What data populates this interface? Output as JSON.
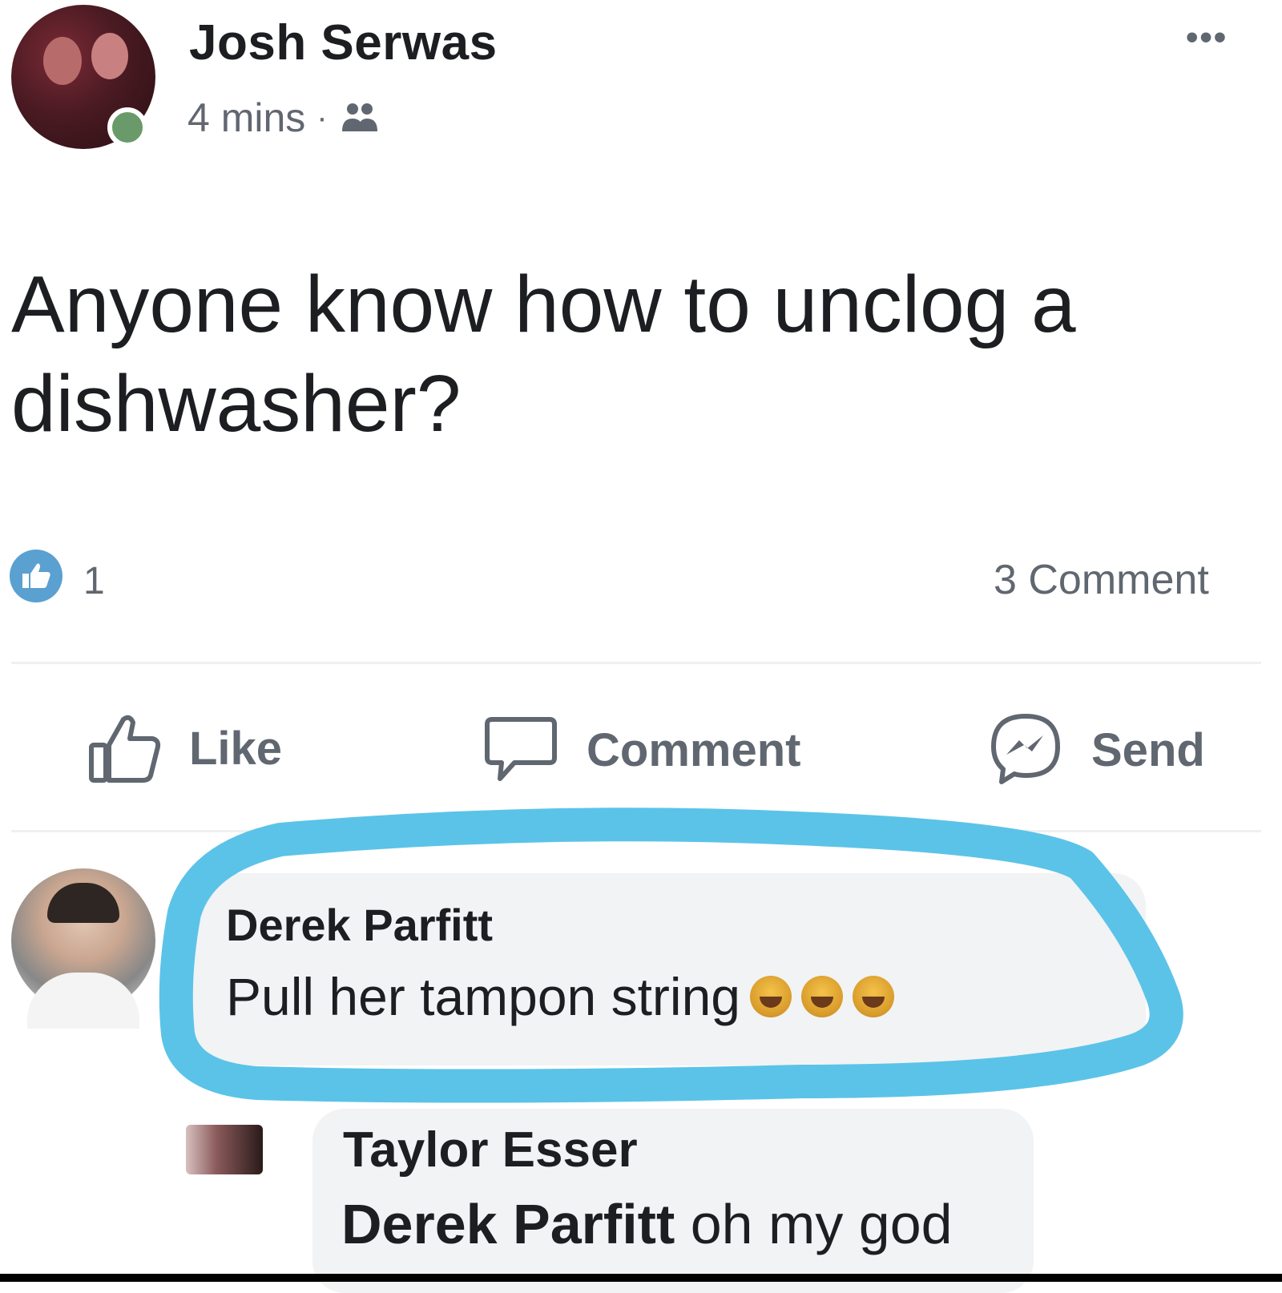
{
  "post": {
    "author": "Josh Serwas",
    "time": "4 mins",
    "separator": "·",
    "text": "Anyone know how to unclog a dishwasher?",
    "reaction_count": "1",
    "comment_count": "3 Comment"
  },
  "actions": {
    "like": "Like",
    "comment": "Comment",
    "send": "Send"
  },
  "comments": [
    {
      "author": "Derek Parfitt",
      "text": "Pull her tampon string",
      "emoji": [
        "laughing-emoji",
        "laughing-emoji",
        "laughing-emoji"
      ]
    },
    {
      "author": "Taylor Esser",
      "mention": "Derek Parfitt",
      "text": " oh my god"
    }
  ],
  "colors": {
    "highlight": "#5bc3e8",
    "reaction": "#5aa0d0",
    "muted_text": "#606770"
  }
}
